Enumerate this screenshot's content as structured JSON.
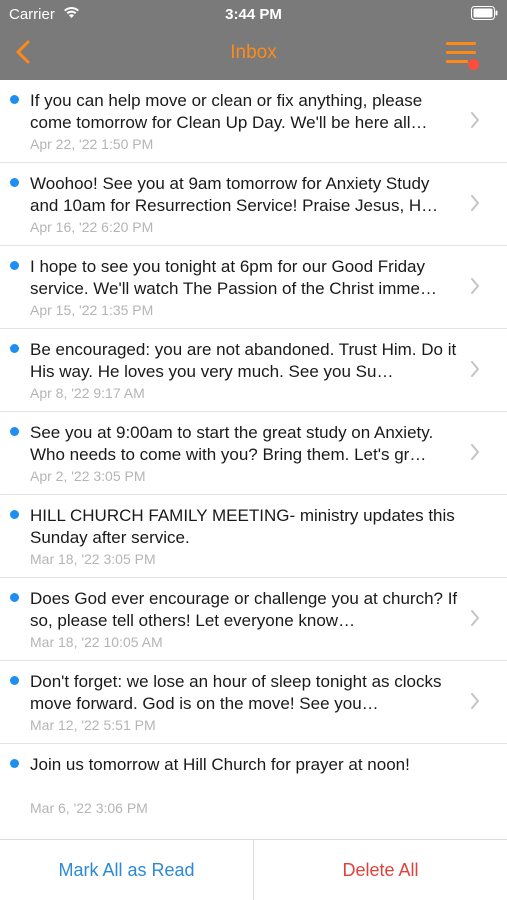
{
  "status_bar": {
    "carrier": "Carrier",
    "time": "3:44 PM"
  },
  "nav": {
    "title": "Inbox",
    "menu_has_badge": true
  },
  "colors": {
    "accent": "#ff8a18",
    "unread_dot": "#1e8ef0",
    "link_blue": "#2b8ad8",
    "delete_red": "#e0413a",
    "badge_red": "#ff4d3d",
    "header_gray": "#7a7a7a"
  },
  "messages": [
    {
      "text": "If you can help move or clean or fix anything, please come tomorrow for Clean Up Day. We'll be here all…",
      "date": "Apr 22, '22 1:50 PM",
      "unread": true,
      "has_chevron": true
    },
    {
      "text": "Woohoo! See you at 9am tomorrow for Anxiety Study and 10am for Resurrection Service! Praise Jesus, H…",
      "date": "Apr 16, '22 6:20 PM",
      "unread": true,
      "has_chevron": true
    },
    {
      "text": "I hope to see you tonight at 6pm for our Good Friday service. We'll watch The Passion of the Christ imme…",
      "date": "Apr 15, '22 1:35 PM",
      "unread": true,
      "has_chevron": true
    },
    {
      "text": "Be encouraged: you are not abandoned. Trust Him. Do it His way. He loves you very much. See you Su…",
      "date": "Apr 8, '22 9:17 AM",
      "unread": true,
      "has_chevron": true
    },
    {
      "text": "See you at 9:00am to start the great study on Anxiety. Who needs to come with you? Bring them. Let's gr…",
      "date": "Apr 2, '22 3:05 PM",
      "unread": true,
      "has_chevron": true
    },
    {
      "text": "HILL CHURCH FAMILY MEETING- ministry updates this Sunday after service.",
      "date": "Mar 18, '22 3:05 PM",
      "unread": true,
      "has_chevron": false
    },
    {
      "text": "Does God ever encourage or challenge you at church? If so, please tell others! Let everyone know…",
      "date": "Mar 18, '22 10:05 AM",
      "unread": true,
      "has_chevron": true
    },
    {
      "text": "Don't forget: we lose an hour of sleep tonight as clocks move forward. God is on the move! See you…",
      "date": "Mar 12, '22 5:51 PM",
      "unread": true,
      "has_chevron": true
    },
    {
      "text": "Join us tomorrow at Hill Church for prayer at noon!",
      "date": "Mar 6, '22 3:06 PM",
      "unread": true,
      "has_chevron": false
    }
  ],
  "actions": {
    "mark_all_read": "Mark All as Read",
    "delete_all": "Delete All"
  }
}
